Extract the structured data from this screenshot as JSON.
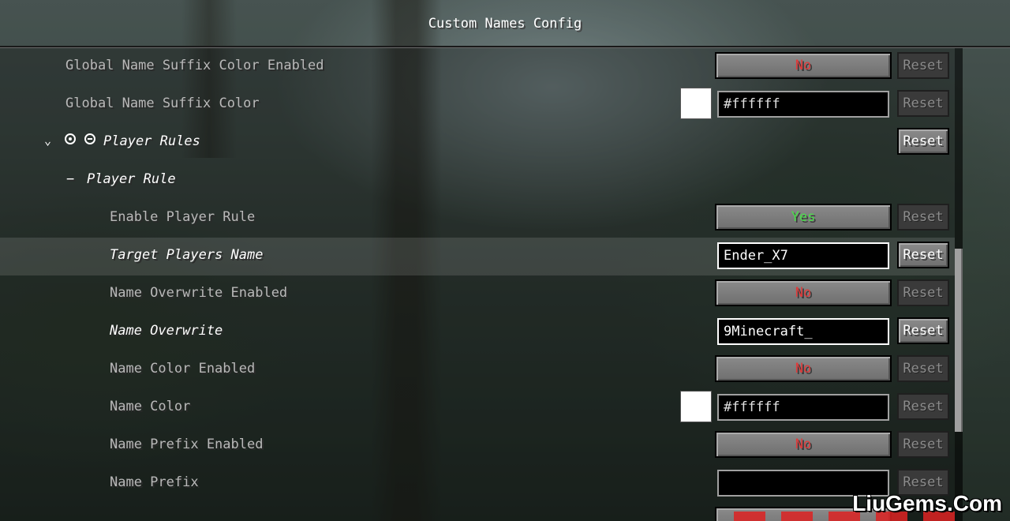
{
  "window": {
    "title": "Custom Names Config"
  },
  "rows": {
    "suffix_color_enabled": {
      "label": "Global Name Suffix Color Enabled",
      "value": "No",
      "reset": "Reset"
    },
    "suffix_color": {
      "label": "Global Name Suffix Color",
      "value": "#ffffff",
      "reset": "Reset"
    },
    "player_rules": {
      "label": "Player Rules",
      "reset": "Reset"
    },
    "player_rule": {
      "label": "Player Rule",
      "prefix": "−"
    },
    "enable_player_rule": {
      "label": "Enable Player Rule",
      "value": "Yes",
      "reset": "Reset"
    },
    "target_players_name": {
      "label": "Target Players Name",
      "value": "Ender_X7",
      "reset": "Reset"
    },
    "name_overwrite_enabled": {
      "label": "Name Overwrite Enabled",
      "value": "No",
      "reset": "Reset"
    },
    "name_overwrite": {
      "label": "Name Overwrite",
      "value": "9Minecraft_",
      "reset": "Reset"
    },
    "name_color_enabled": {
      "label": "Name Color Enabled",
      "value": "No",
      "reset": "Reset"
    },
    "name_color": {
      "label": "Name Color",
      "value": "#ffffff",
      "reset": "Reset"
    },
    "name_prefix_enabled": {
      "label": "Name Prefix Enabled",
      "value": "No",
      "reset": "Reset"
    },
    "name_prefix": {
      "label": "Name Prefix",
      "value": "",
      "reset": "Reset"
    }
  },
  "icons": {
    "collapse": "chevron-down-icon",
    "add": "add-circle-icon",
    "remove": "remove-circle-icon"
  },
  "colors": {
    "no": "#e03a3a",
    "yes": "#4cdd4c",
    "swatch": "#ffffff"
  },
  "watermark": "LiuGems.Com"
}
